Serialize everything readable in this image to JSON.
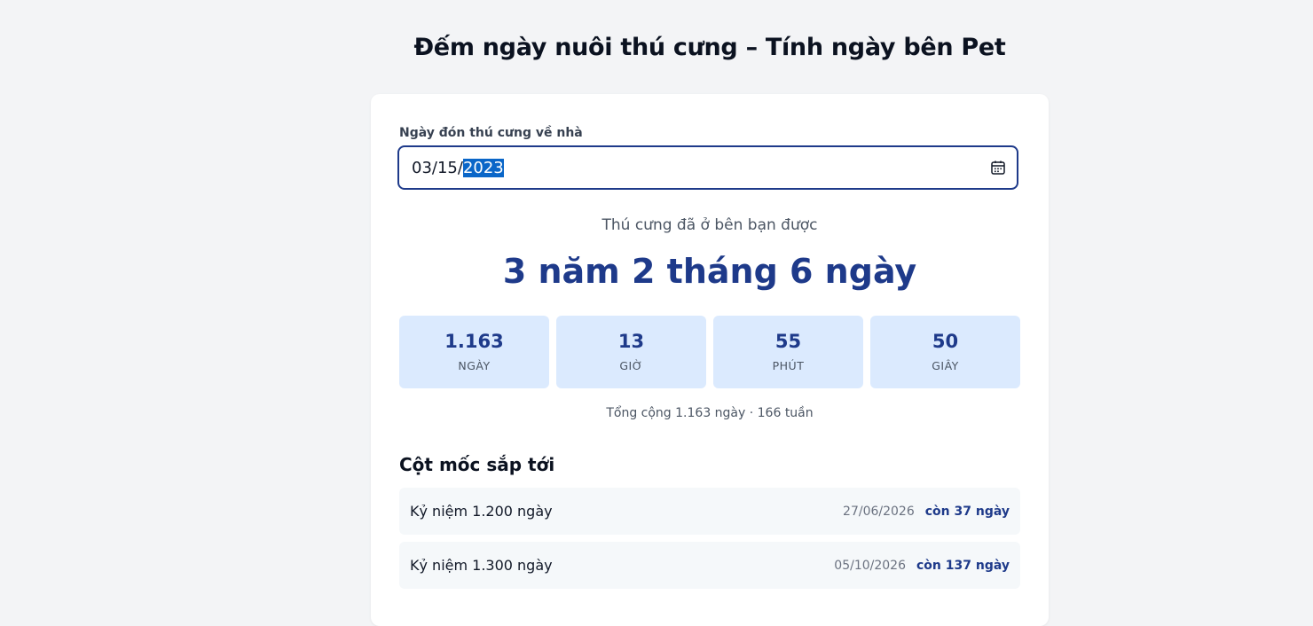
{
  "header": {
    "title": "Đếm ngày nuôi thú cưng – Tính ngày bên Pet"
  },
  "form": {
    "label": "Ngày đón thú cưng về nhà",
    "date_prefix": "03/15/",
    "date_selected": "2023",
    "icon": "calendar-icon"
  },
  "result": {
    "since_label": "Thú cưng đã ở bên bạn được",
    "duration": "3 năm 2 tháng 6 ngày",
    "stats": [
      {
        "value": "1.163",
        "unit": "NGÀY"
      },
      {
        "value": "13",
        "unit": "GIỜ"
      },
      {
        "value": "55",
        "unit": "PHÚT"
      },
      {
        "value": "50",
        "unit": "GIÂY"
      }
    ],
    "total": "Tổng cộng 1.163 ngày · 166 tuần"
  },
  "milestones": {
    "title": "Cột mốc sắp tới",
    "items": [
      {
        "name": "Kỷ niệm 1.200 ngày",
        "date": "27/06/2026",
        "remain": "còn 37 ngày"
      },
      {
        "name": "Kỷ niệm 1.300 ngày",
        "date": "05/10/2026",
        "remain": "còn 137 ngày"
      }
    ]
  },
  "colors": {
    "accent": "#1e3a8a",
    "stat_bg": "#dbeafe",
    "page_bg": "#f3f4f6"
  }
}
